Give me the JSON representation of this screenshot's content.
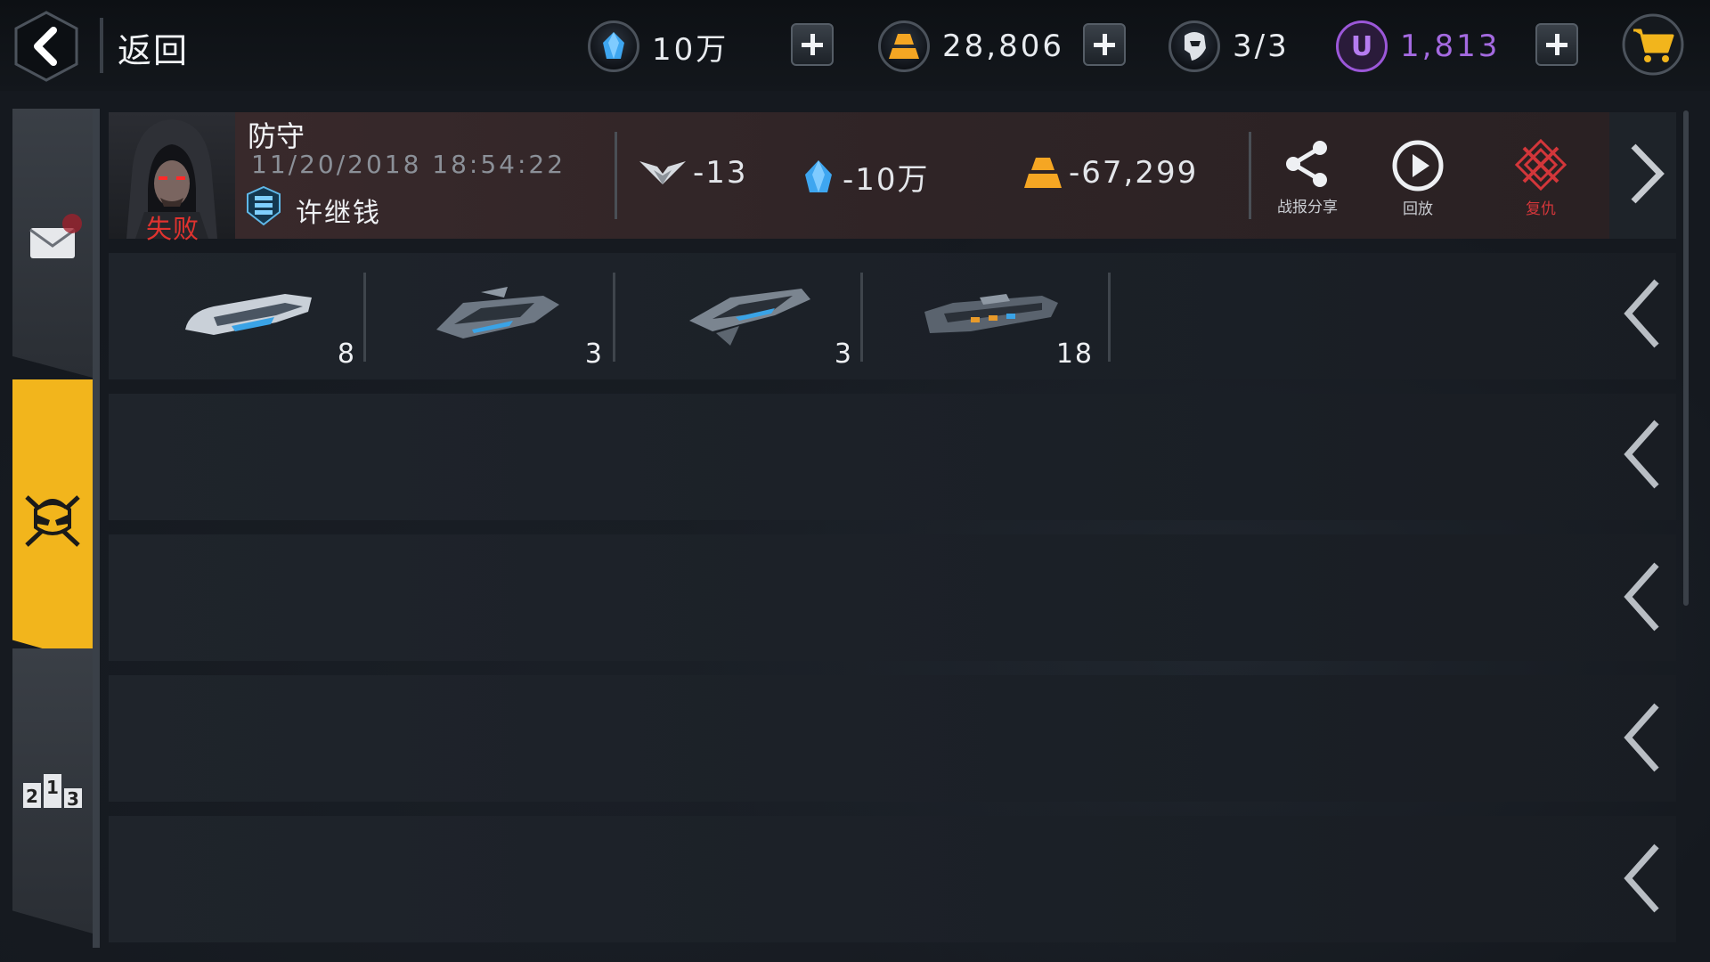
{
  "header": {
    "back_label": "返回",
    "resources": [
      {
        "name": "crystal",
        "icon": "crystal-icon",
        "value": "10万",
        "has_plus": true
      },
      {
        "name": "gold",
        "icon": "gold-bar-icon",
        "value": "28,806",
        "has_plus": true
      },
      {
        "name": "energy",
        "icon": "pilot-helmet-icon",
        "value": "3/3",
        "has_plus": false
      },
      {
        "name": "u-credits",
        "icon": "u-coin-icon",
        "value": "1,813",
        "has_plus": true
      }
    ],
    "cart_icon": "shopping-cart-icon"
  },
  "sidebar": {
    "tabs": [
      {
        "name": "mail",
        "icon": "mail-icon",
        "active": false
      },
      {
        "name": "battle-reports",
        "icon": "battle-skull-icon",
        "active": true
      },
      {
        "name": "rankings",
        "icon": "podium-icon",
        "active": false
      }
    ],
    "podium_digits": [
      "2",
      "1",
      "3"
    ]
  },
  "report": {
    "mode": "防守",
    "datetime": "11/20/2018 18:54:22",
    "result": "失败",
    "player_name": "许继钱",
    "stats": [
      {
        "icon": "wings-icon",
        "value": "-13"
      },
      {
        "icon": "crystal-icon",
        "value": "-10万"
      },
      {
        "icon": "gold-bar-icon",
        "value": "-67,299"
      }
    ],
    "actions": [
      {
        "icon": "share-icon",
        "label": "战报分享"
      },
      {
        "icon": "play-icon",
        "label": "回放"
      },
      {
        "icon": "revenge-icon",
        "label": "复仇"
      }
    ],
    "fleet": [
      {
        "ship": "frigate",
        "count": "8"
      },
      {
        "ship": "destroyer",
        "count": "3"
      },
      {
        "ship": "cruiser",
        "count": "3"
      },
      {
        "ship": "battleship",
        "count": "18"
      }
    ]
  },
  "colors": {
    "accent_yellow": "#f2b51c",
    "defeat_red": "#e0332f",
    "u_purple": "#9b57d8",
    "crystal_blue": "#3ea6f0",
    "gold_orange": "#f5a623"
  }
}
